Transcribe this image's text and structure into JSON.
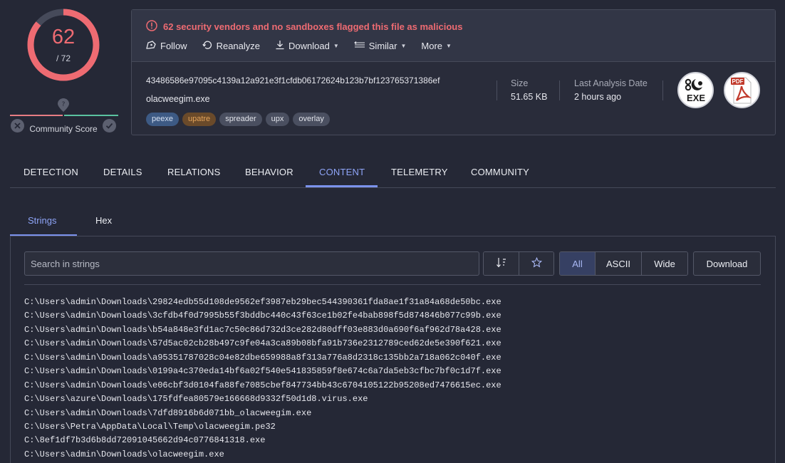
{
  "score": {
    "detections": "62",
    "total": "/ 72",
    "accent": "#ee6b72"
  },
  "community": {
    "label": "Community Score"
  },
  "alert": {
    "text": "62 security vendors and no sandboxes flagged this file as malicious"
  },
  "actions": [
    {
      "label": "Follow",
      "icon": "follow-icon"
    },
    {
      "label": "Reanalyze",
      "icon": "refresh-icon"
    },
    {
      "label": "Download",
      "icon": "download-icon"
    },
    {
      "label": "Similar",
      "icon": "similar-icon"
    },
    {
      "label": "More"
    }
  ],
  "file": {
    "hash": "43486586e97095c4139a12a921e3f1cfdb06172624b123b7bf123765371386ef",
    "name": "olacweegim.exe",
    "tags": [
      "peexe",
      "upatre",
      "spreader",
      "upx",
      "overlay"
    ]
  },
  "meta": {
    "size_label": "Size",
    "size_value": "51.65 KB",
    "date_label": "Last Analysis Date",
    "date_value": "2 hours ago"
  },
  "filetypes": {
    "exe_label": "EXE",
    "pdf_label": "PDF"
  },
  "tabs": [
    "DETECTION",
    "DETAILS",
    "RELATIONS",
    "BEHAVIOR",
    "CONTENT",
    "TELEMETRY",
    "COMMUNITY"
  ],
  "active_tab": "CONTENT",
  "subtabs": [
    "Strings",
    "Hex"
  ],
  "active_subtab": "Strings",
  "search": {
    "placeholder": "Search in strings",
    "value": ""
  },
  "filters": [
    "All",
    "ASCII",
    "Wide"
  ],
  "active_filter": "All",
  "download_label": "Download",
  "strings": [
    "C:\\Users\\admin\\Downloads\\29824edb55d108de9562ef3987eb29bec544390361fda8ae1f31a84a68de50bc.exe",
    "C:\\Users\\admin\\Downloads\\3cfdb4f0d7995b55f3bddbc440c43f63ce1b02fe4bab898f5d874846b077c99b.exe",
    "C:\\Users\\admin\\Downloads\\b54a848e3fd1ac7c50c86d732d3ce282d80dff03e883d0a690f6af962d78a428.exe",
    "C:\\Users\\admin\\Downloads\\57d5ac02cb28b497c9fe04a3ca89b08bfa91b736e2312789ced62de5e390f621.exe",
    "C:\\Users\\admin\\Downloads\\a95351787028c04e82dbe659988a8f313a776a8d2318c135bb2a718a062c040f.exe",
    "C:\\Users\\admin\\Downloads\\0199a4c370eda14bf6a02f540e541835859f8e674c6a7da5eb3cfbc7bf0c1d7f.exe",
    "C:\\Users\\admin\\Downloads\\e06cbf3d0104fa88fe7085cbef847734bb43c6704105122b95208ed7476615ec.exe",
    "C:\\Users\\azure\\Downloads\\175fdfea80579e166668d9332f50d1d8.virus.exe",
    "C:\\Users\\admin\\Downloads\\7dfd8916b6d071bb_olacweegim.exe",
    "C:\\Users\\Petra\\AppData\\Local\\Temp\\olacweegim.pe32",
    "C:\\8ef1df7b3d6b8dd72091045662d94c0776841318.exe",
    "C:\\Users\\admin\\Downloads\\olacweegim.exe"
  ]
}
